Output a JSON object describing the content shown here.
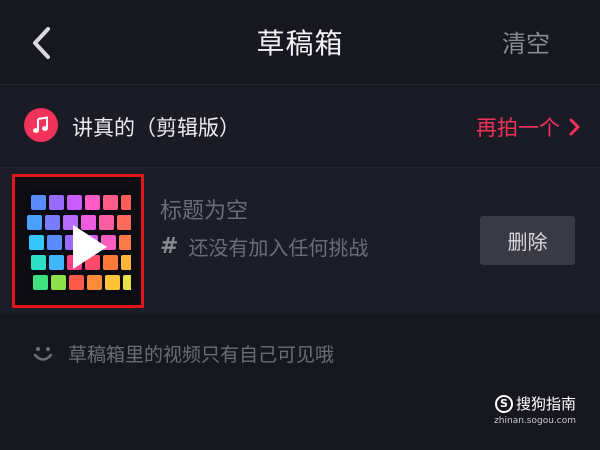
{
  "header": {
    "title": "草稿箱",
    "clear_label": "清空"
  },
  "music": {
    "icon": "music-note-icon",
    "title": "讲真的（剪辑版）",
    "reshoot_label": "再拍一个",
    "accent_color": "#f0335a"
  },
  "draft": {
    "title": "标题为空",
    "challenge": "还没有加入任何挑战",
    "delete_label": "删除",
    "thumbnail_icon": "play-icon"
  },
  "notice": {
    "text": "草稿箱里的视频只有自己可见哦"
  },
  "watermark": {
    "brand": "搜狗指南",
    "url": "zhinan.sogou.com"
  }
}
